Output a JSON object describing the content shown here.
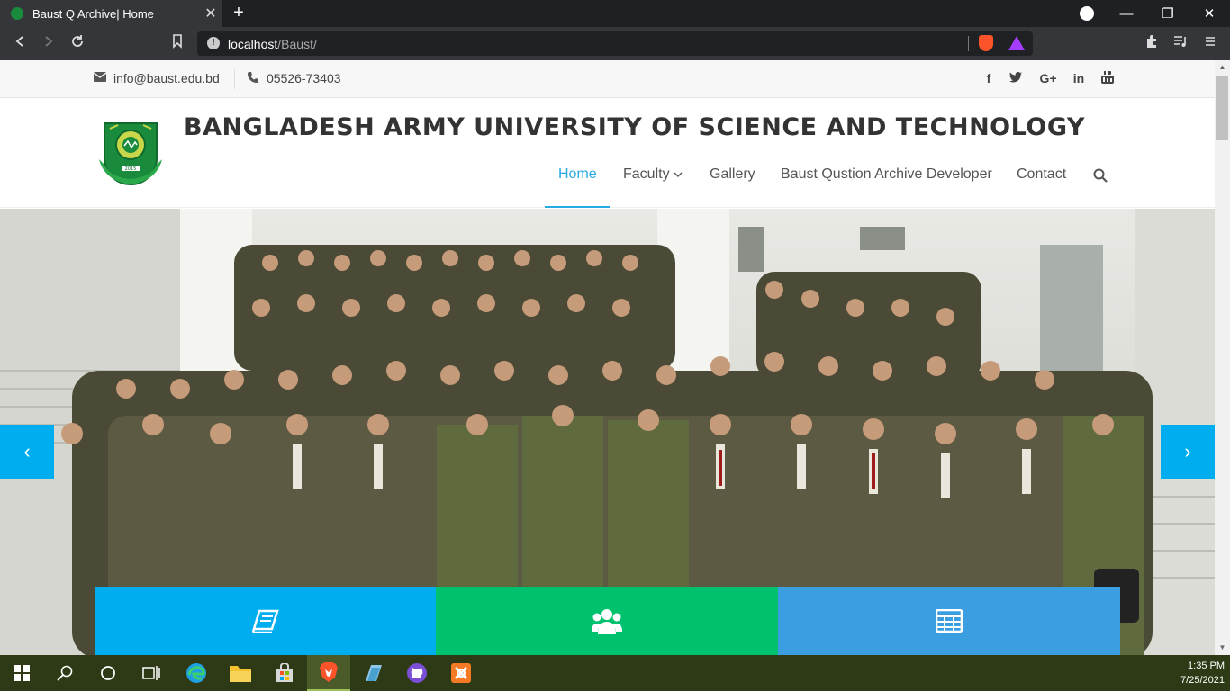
{
  "browser": {
    "tab_title": "Baust Q Archive| Home",
    "url_host": "localhost",
    "url_path": "/Baust/"
  },
  "topbar": {
    "email": "info@baust.edu.bd",
    "phone": "05526-73403",
    "social_icons": [
      "facebook-icon",
      "twitter-icon",
      "google-plus-icon",
      "linkedin-icon",
      "youtube-icon"
    ],
    "social_glyphs": {
      "facebook": "f",
      "twitter": "t",
      "google_plus": "G+",
      "linkedin": "in"
    }
  },
  "header": {
    "brand": "BANGLADESH ARMY UNIVERSITY OF SCIENCE AND TECHNOLOGY",
    "logo_year": "2015",
    "nav": [
      {
        "label": "Home",
        "active": true
      },
      {
        "label": "Faculty",
        "has_dropdown": true
      },
      {
        "label": "Gallery"
      },
      {
        "label": "Baust Qustion Archive Developer"
      },
      {
        "label": "Contact"
      }
    ]
  },
  "hero": {
    "prev_arrow": "‹",
    "next_arrow": "›",
    "features": [
      {
        "icon": "book-icon",
        "color": "#00aeef"
      },
      {
        "icon": "users-icon",
        "color": "#00c26e"
      },
      {
        "icon": "table-icon",
        "color": "#3a9ee0"
      }
    ]
  },
  "taskbar": {
    "time": "1:35 PM",
    "date": "7/25/2021"
  },
  "colors": {
    "accent": "#29a9e1",
    "slider_arrow": "#00aeef"
  }
}
